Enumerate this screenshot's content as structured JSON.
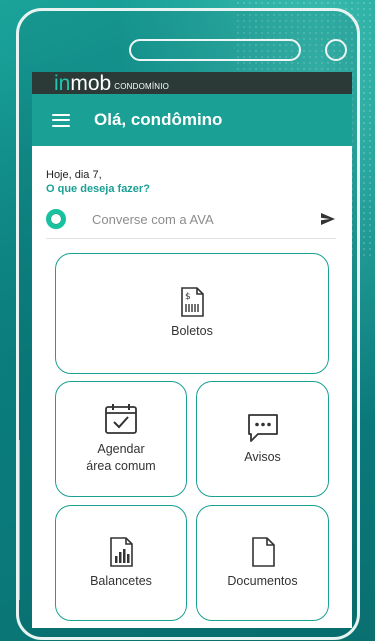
{
  "brand": {
    "in": "in",
    "mob": "mob",
    "sub": "CONDOMÍNIO"
  },
  "header": {
    "title": "Olá, condômino",
    "menu_icon": "menu-icon"
  },
  "greeting": {
    "line1": "Hoje, dia 7,",
    "question": "O que deseja fazer?"
  },
  "chat": {
    "placeholder": "Converse com a AVA",
    "icon": "ava-icon",
    "send_icon": "send-icon"
  },
  "tiles": {
    "boletos": {
      "label": "Boletos",
      "icon": "boleto-icon"
    },
    "agendar": {
      "line1": "Agendar",
      "line2": "área comum",
      "icon": "calendar-check-icon"
    },
    "avisos": {
      "label": "Avisos",
      "icon": "chat-bubble-icon"
    },
    "balancetes": {
      "label": "Balancetes",
      "icon": "report-chart-icon"
    },
    "documentos": {
      "label": "Documentos",
      "icon": "document-icon"
    }
  },
  "colors": {
    "accent": "#1aa094",
    "brand_bar": "#2b3a37",
    "background": "#0e8a86"
  }
}
